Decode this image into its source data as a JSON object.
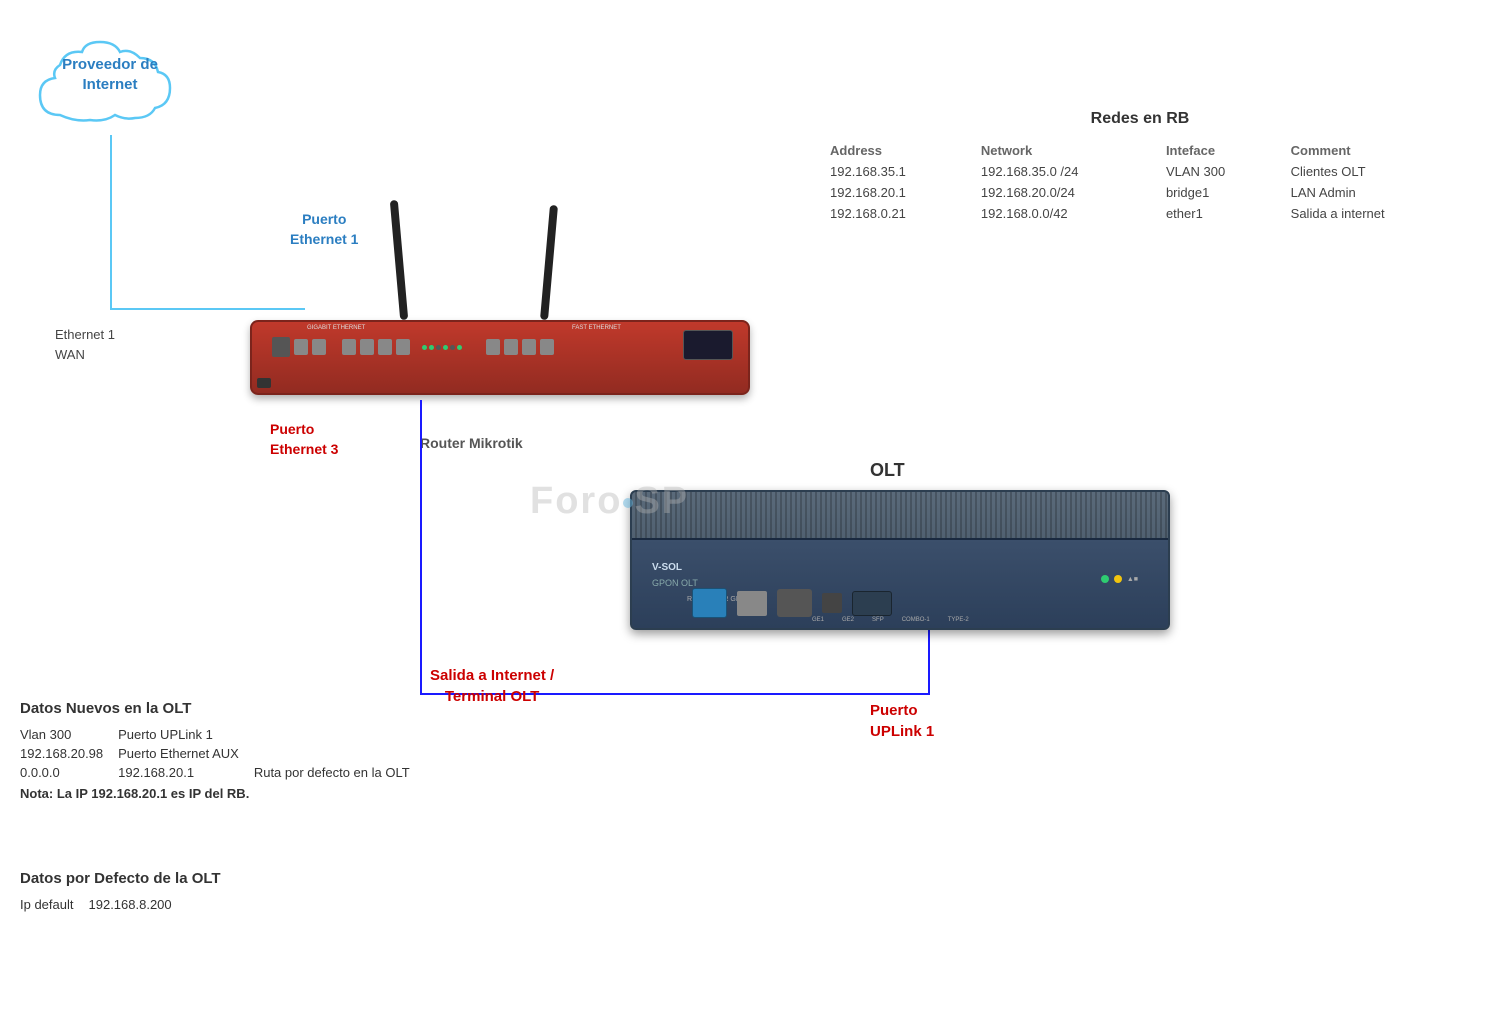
{
  "cloud": {
    "label_line1": "Proveedor de",
    "label_line2": "Internet"
  },
  "labels": {
    "eth1_wan_line1": "Ethernet 1",
    "eth1_wan_line2": "WAN",
    "puerto_eth1_line1": "Puerto",
    "puerto_eth1_line2": "Ethernet 1",
    "puerto_eth3_line1": "Puerto",
    "puerto_eth3_line2": "Ethernet 3",
    "router_label": "Router Mikrotik",
    "salida_line1": "Salida a Internet /",
    "salida_line2": "Terminal  OLT",
    "puerto_uplink_line1": "Puerto",
    "puerto_uplink_line2": "UPLink 1",
    "olt_title": "OLT",
    "olt_device_brand": "V-SOL",
    "olt_device_type": "GPON OLT",
    "watermark": "Foro SP"
  },
  "redes_rb": {
    "title": "Redes en RB",
    "columns": {
      "address": "Address",
      "network": "Network",
      "interface": "Inteface",
      "comment": "Comment"
    },
    "rows": [
      {
        "address": "192.168.35.1",
        "network": "192.168.35.0 /24",
        "interface": "VLAN 300",
        "comment": "Clientes OLT"
      },
      {
        "address": "192.168.20.1",
        "network": "192.168.20.0/24",
        "interface": "bridge1",
        "comment": "LAN Admin"
      },
      {
        "address": "192.168.0.21",
        "network": "192.168.0.0/42",
        "interface": "ether1",
        "comment": "Salida a internet"
      }
    ]
  },
  "datos_nuevos": {
    "title": "Datos Nuevos en  la OLT",
    "rows": [
      {
        "col1": "Vlan 300",
        "col2": "Puerto UPLink 1"
      },
      {
        "col1": "192.168.20.98",
        "col2": "Puerto Ethernet AUX"
      },
      {
        "col1": "0.0.0.0",
        "col2": "192.168.20.1",
        "col3": "Ruta  por defecto en la OLT"
      }
    ],
    "note": "Nota: La IP 192.168.20.1 es IP del RB."
  },
  "datos_defecto": {
    "title": "Datos por Defecto de la OLT",
    "rows": [
      {
        "col1": "Ip default",
        "col2": "192.168.8.200"
      }
    ]
  }
}
